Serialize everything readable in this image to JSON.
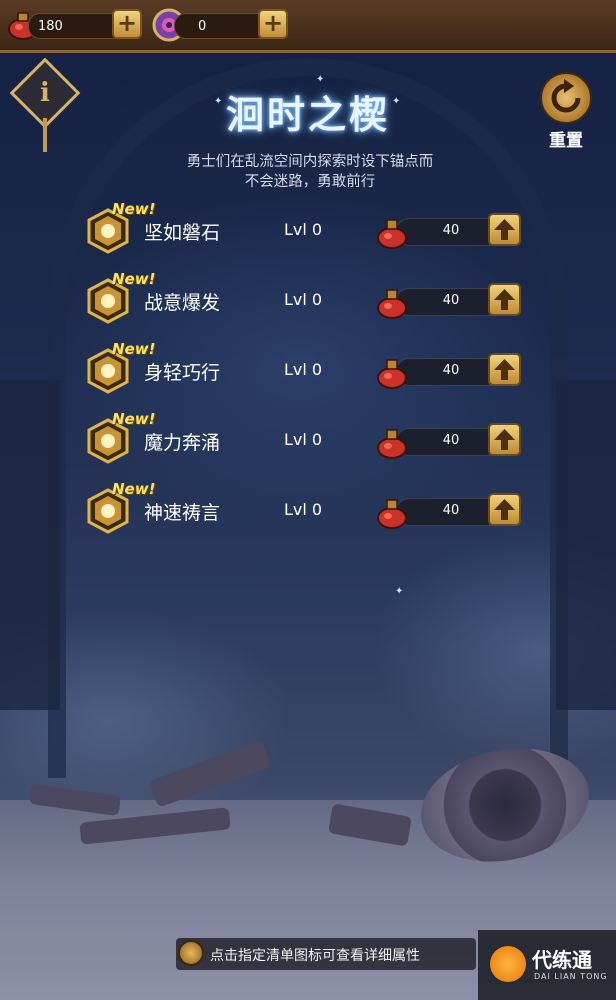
{
  "top_bar": {
    "potion_amount": "180",
    "orb_amount": "0",
    "potion_icon": "red-potion-icon",
    "orb_icon": "purple-orb-icon"
  },
  "title": "洄时之楔",
  "description_line1": "勇士们在乱流空间内探索时设下锚点而",
  "description_line2": "不会迷路，勇敢前行",
  "reset_label": "重置",
  "skills": [
    {
      "badge": "New!",
      "name": "坚如磐石",
      "level": "Lvl 0",
      "cost": "40",
      "icon": "shield-icon"
    },
    {
      "badge": "New!",
      "name": "战意爆发",
      "level": "Lvl 0",
      "cost": "40",
      "icon": "axe-icon"
    },
    {
      "badge": "New!",
      "name": "身轻巧行",
      "level": "Lvl 0",
      "cost": "40",
      "icon": "wing-boot-icon"
    },
    {
      "badge": "New!",
      "name": "魔力奔涌",
      "level": "Lvl 0",
      "cost": "40",
      "icon": "sparkle-icon"
    },
    {
      "badge": "New!",
      "name": "神速祷言",
      "level": "Lvl 0",
      "cost": "40",
      "icon": "flame-icon"
    }
  ],
  "hint": "点击指定清单图标可查看详细属性",
  "watermark": {
    "name": "代练通",
    "pinyin": "DAI LIAN TONG"
  },
  "colors": {
    "gold": "#d7b36a",
    "new_badge": "#ffe25a",
    "title_glow": "#6fb6ff"
  }
}
